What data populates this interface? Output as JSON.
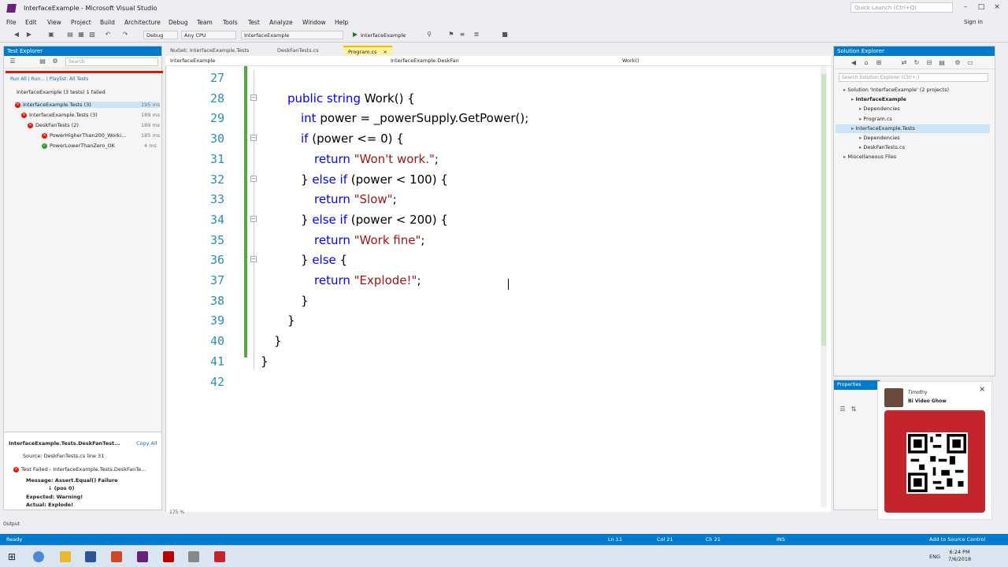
{
  "window": {
    "title": "InterfaceExample - Microsoft Visual Studio",
    "quick_launch_placeholder": "Quick Launch (Ctrl+Q)",
    "sign_in": "Sign in"
  },
  "menu": [
    "File",
    "Edit",
    "View",
    "Project",
    "Build",
    "Architecture",
    "Debug",
    "Team",
    "Tools",
    "Test",
    "Analyze",
    "Window",
    "Help"
  ],
  "toolbar": {
    "config": "Debug",
    "platform": "Any CPU",
    "startup": "InterfaceExample",
    "start_label": "InterfaceExample"
  },
  "test_explorer": {
    "title": "Test Explorer",
    "search_placeholder": "Search",
    "links": "Run All | Run... | Playlist: All Tests",
    "summary": "InterfaceExample (3 tests) 1 failed",
    "tree": [
      {
        "label": "InterfaceExample.Tests (3)",
        "status": "fail",
        "dur": "195 ms"
      },
      {
        "label": "InterfaceExample.Tests (3)",
        "status": "fail",
        "dur": "189 ms"
      },
      {
        "label": "DeskFanTests (2)",
        "status": "fail",
        "dur": "189 ms"
      },
      {
        "label": "PowerHigherThan200_Worki...",
        "status": "fail",
        "dur": "185 ms"
      },
      {
        "label": "PowerLowerThanZero_OK",
        "status": "pass",
        "dur": "4 ms"
      }
    ]
  },
  "test_detail": {
    "name": "InterfaceExample.Tests.DeskFanTest...",
    "copy": "Copy All",
    "source": "Source: DeskFanTests.cs line 31",
    "result": "Test Failed - InterfaceExample.Tests.DeskFanTe...",
    "message": "Message: Assert.Equal() Failure",
    "pos": "↓ (pos 0)",
    "expected": "Expected: Warning!",
    "actual": "Actual:   Explode!"
  },
  "tabs": [
    {
      "label": "NuGet: InterfaceExample.Tests",
      "active": false
    },
    {
      "label": "DeskFanTests.cs",
      "active": false
    },
    {
      "label": "Program.cs",
      "active": true
    }
  ],
  "navbar": {
    "project": "InterfaceExample",
    "class": "InterfaceExample.DeskFan",
    "member": "Work()"
  },
  "code": {
    "lines": [
      {
        "n": "27",
        "html": ""
      },
      {
        "n": "28",
        "indent": 0,
        "tokens": [
          [
            "kw",
            "public "
          ],
          [
            "kw",
            "string "
          ],
          [
            "t",
            "Work() {"
          ]
        ]
      },
      {
        "n": "29",
        "indent": 1,
        "tokens": [
          [
            "kw",
            "int "
          ],
          [
            "t",
            "power = _powerSupply.GetPower();"
          ]
        ]
      },
      {
        "n": "30",
        "indent": 1,
        "tokens": [
          [
            "kw",
            "if "
          ],
          [
            "t",
            "(power <= 0) {"
          ]
        ]
      },
      {
        "n": "31",
        "indent": 2,
        "tokens": [
          [
            "kw",
            "return "
          ],
          [
            "str",
            "\"Won't work.\""
          ],
          [
            "t",
            ";"
          ]
        ]
      },
      {
        "n": "32",
        "indent": 1,
        "tokens": [
          [
            "t",
            "} "
          ],
          [
            "kw",
            "else if "
          ],
          [
            "t",
            "(power < 100) {"
          ]
        ]
      },
      {
        "n": "33",
        "indent": 2,
        "tokens": [
          [
            "kw",
            "return "
          ],
          [
            "str",
            "\"Slow\""
          ],
          [
            "t",
            ";"
          ]
        ]
      },
      {
        "n": "34",
        "indent": 1,
        "tokens": [
          [
            "t",
            "} "
          ],
          [
            "kw",
            "else if "
          ],
          [
            "t",
            "(power < 200) {"
          ]
        ]
      },
      {
        "n": "35",
        "indent": 2,
        "tokens": [
          [
            "kw",
            "return "
          ],
          [
            "str",
            "\"Work fine\""
          ],
          [
            "t",
            ";"
          ]
        ]
      },
      {
        "n": "36",
        "indent": 1,
        "tokens": [
          [
            "t",
            "} "
          ],
          [
            "kw",
            "else "
          ],
          [
            "t",
            "{"
          ]
        ]
      },
      {
        "n": "37",
        "indent": 2,
        "tokens": [
          [
            "kw",
            "return "
          ],
          [
            "str",
            "\"Explode!\""
          ],
          [
            "t",
            ";"
          ]
        ]
      },
      {
        "n": "38",
        "indent": 1,
        "tokens": [
          [
            "t",
            "}"
          ]
        ]
      },
      {
        "n": "39",
        "indent": 0,
        "tokens": [
          [
            "t",
            "}"
          ]
        ]
      },
      {
        "n": "40",
        "indent": -1,
        "tokens": [
          [
            "t",
            "}"
          ]
        ]
      },
      {
        "n": "41",
        "indent": -2,
        "tokens": [
          [
            "t",
            "}"
          ]
        ]
      },
      {
        "n": "42",
        "indent": 0,
        "tokens": []
      }
    ],
    "zoom": "175 %"
  },
  "solution_explorer": {
    "title": "Solution Explorer",
    "search_placeholder": "Search Solution Explorer (Ctrl+;)",
    "items": [
      {
        "label": "Solution 'InterfaceExample' (2 projects)",
        "level": 0
      },
      {
        "label": "InterfaceExample",
        "level": 1,
        "bold": true
      },
      {
        "label": "Dependencies",
        "level": 2
      },
      {
        "label": "Program.cs",
        "level": 2
      },
      {
        "label": "InterfaceExample.Tests",
        "level": 1
      },
      {
        "label": "Dependencies",
        "level": 2
      },
      {
        "label": "DeskFanTests.cs",
        "level": 2
      },
      {
        "label": "Miscellaneous Files",
        "level": 0
      }
    ]
  },
  "properties": {
    "title": "Properties"
  },
  "webcam": {
    "name": "Timothy",
    "sub": "Bi Video Ghow"
  },
  "status": {
    "ready": "Ready",
    "ln": "Ln 11",
    "col": "Col 21",
    "ch": "Ch 21",
    "ins": "INS",
    "source_control": "Add to Source Control"
  },
  "taskbar": {
    "lang": "ENG",
    "time": "6:24 PM",
    "date": "7/6/2018"
  },
  "bottom_left": "Output",
  "colors": {
    "accent": "#007acc",
    "keyword": "#0000ff",
    "string": "#a31515",
    "line_number": "#2b91af",
    "fail": "#e51400",
    "pass": "#339933"
  }
}
